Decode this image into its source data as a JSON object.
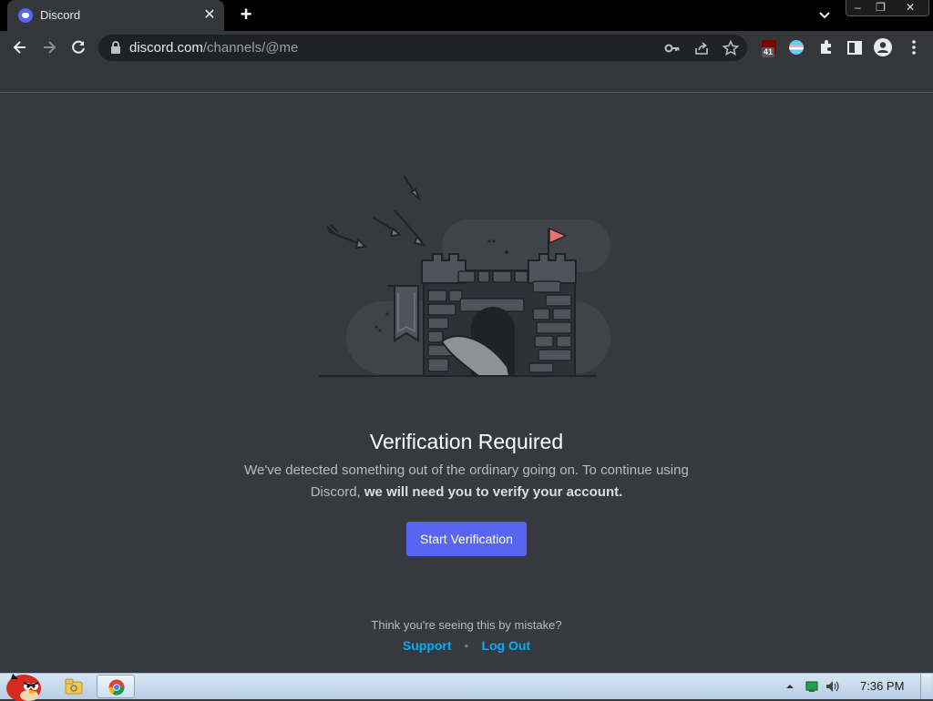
{
  "browser": {
    "tab_title": "Discord",
    "tab_close": "✕",
    "new_tab": "+",
    "url_host": "discord.com",
    "url_path": "/channels/@me",
    "ublock_count": "41",
    "window_buttons": [
      "–",
      "❐",
      "✕"
    ]
  },
  "page": {
    "title": "Verification Required",
    "desc_part1": "We've detected something out of the ordinary going on. To continue using Discord,",
    "desc_bold": "we will need you to verify your account.",
    "start_button": "Start Verification",
    "mistake_text": "Think you're seeing this by mistake?",
    "support_link": "Support",
    "separator": "•",
    "logout_link": "Log Out"
  },
  "taskbar": {
    "clock": "7:36 PM"
  },
  "colors": {
    "page_bg": "#36393f",
    "brand": "#5865f2",
    "link": "#00aff4",
    "flag": "#ed6f6f"
  },
  "icons": [
    "back-arrow-icon",
    "forward-arrow-icon",
    "reload-icon",
    "lock-icon",
    "key-icon",
    "share-icon",
    "star-icon",
    "ublock-icon",
    "globe-extension-icon",
    "puzzle-icon",
    "sidepanel-icon",
    "profile-icon",
    "menu-dots-icon",
    "angry-bird-start-icon",
    "explorer-icon",
    "chrome-icon",
    "tray-arrow-icon",
    "network-icon",
    "volume-icon"
  ]
}
